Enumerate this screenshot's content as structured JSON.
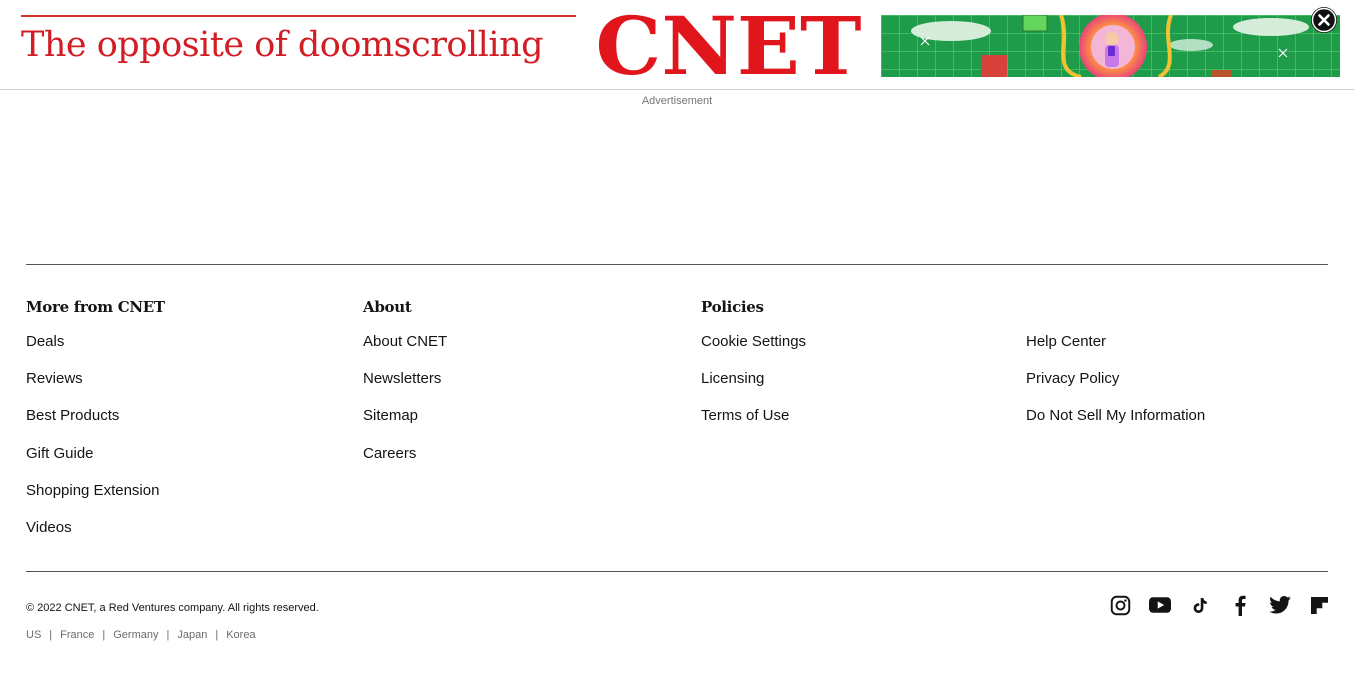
{
  "ad": {
    "tagline": "The opposite of doomscrolling",
    "logo_text": "CNET",
    "close_icon": "close-circle-icon",
    "label": "Advertisement"
  },
  "footer": {
    "columns": [
      {
        "heading": "More from CNET",
        "links": [
          "Deals",
          "Reviews",
          "Best Products",
          "Gift Guide",
          "Shopping Extension",
          "Videos"
        ]
      },
      {
        "heading": "About",
        "links": [
          "About CNET",
          "Newsletters",
          "Sitemap",
          "Careers"
        ]
      },
      {
        "heading": "Policies",
        "links": [
          "Cookie Settings",
          "Licensing",
          "Terms of Use"
        ]
      },
      {
        "heading": "",
        "links": [
          "Help Center",
          "Privacy Policy",
          "Do Not Sell My Information"
        ]
      }
    ],
    "copyright": "© 2022 CNET, a Red Ventures company. All rights reserved.",
    "editions": [
      "US",
      "France",
      "Germany",
      "Japan",
      "Korea"
    ],
    "social_icons": [
      "instagram-icon",
      "youtube-icon",
      "tiktok-icon",
      "facebook-icon",
      "twitter-icon",
      "flipboard-icon"
    ]
  },
  "colors": {
    "brand_red": "#d21d24"
  }
}
